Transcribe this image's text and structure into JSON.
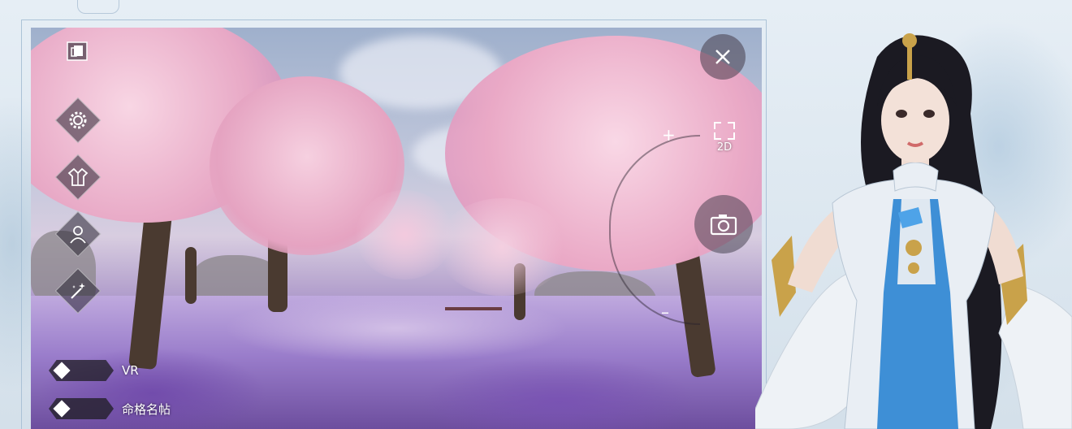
{
  "colors": {
    "accent_blue": "#3e8fd6",
    "ui_dark": "#2a2632",
    "blossom_pink": "#f2c3d6",
    "meadow_purple": "#8a6cc0",
    "panel_bg": "#dde7f0"
  },
  "top_left": {
    "icon": "window-icon"
  },
  "left_menu": [
    {
      "name": "settings",
      "icon": "gear-icon"
    },
    {
      "name": "outfit",
      "icon": "robe-icon"
    },
    {
      "name": "character",
      "icon": "portrait-icon"
    },
    {
      "name": "effects",
      "icon": "magic-wand-icon"
    }
  ],
  "right_controls": {
    "close_icon": "close-icon",
    "view_mode_label": "2D",
    "camera_icon": "camera-icon",
    "zoom_in_symbol": "+",
    "zoom_out_symbol": "–"
  },
  "toggles": [
    {
      "label": "VR"
    },
    {
      "label": "命格名帖"
    }
  ]
}
